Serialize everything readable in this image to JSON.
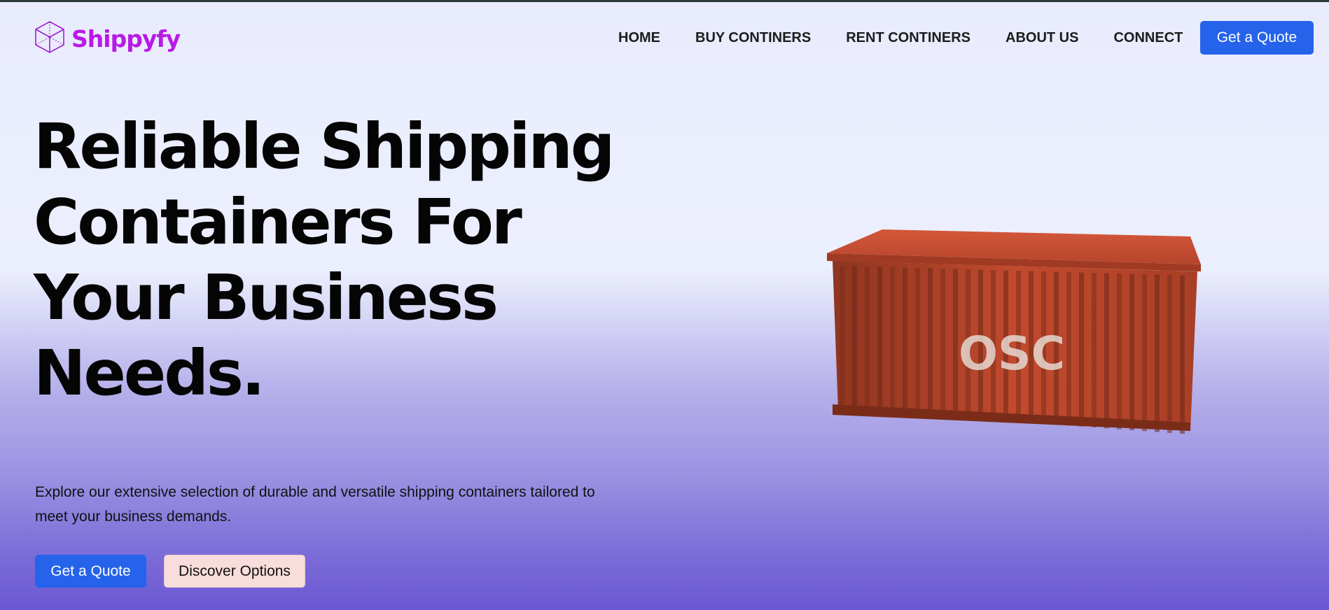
{
  "brand": {
    "name": "Shippyfy",
    "logo_icon": "cube-icon",
    "color": "#b81ae6"
  },
  "nav": {
    "items": [
      {
        "label": "HOME"
      },
      {
        "label": "BUY CONTINERS"
      },
      {
        "label": "RENT CONTINERS"
      },
      {
        "label": "ABOUT US"
      },
      {
        "label": "CONNECT"
      }
    ],
    "cta_label": "Get a Quote"
  },
  "hero": {
    "title_lines": [
      "Reliable Shipping",
      "Containers For",
      "Your Business",
      "Needs."
    ],
    "description": "Explore our extensive selection of durable and versatile shipping containers tailored to meet your business demands.",
    "primary_button": "Get a Quote",
    "secondary_button": "Discover Options",
    "image_text": "OSC"
  },
  "colors": {
    "accent": "#2563eb",
    "secondary_button_bg": "#f9dcdc",
    "container_red": "#c94a2c"
  }
}
